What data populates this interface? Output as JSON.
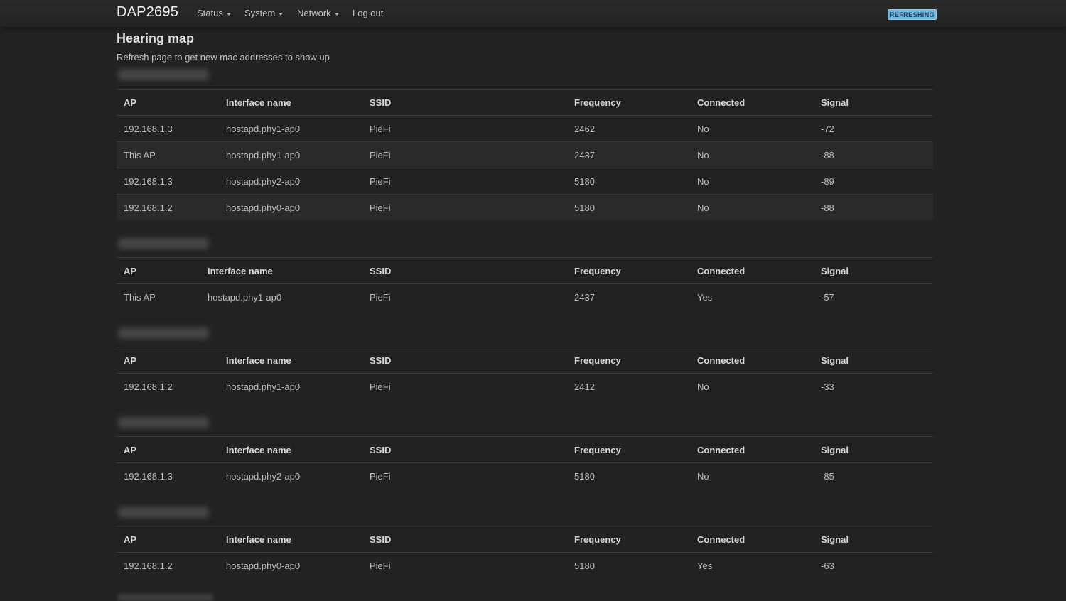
{
  "app": {
    "brand": "DAP2695",
    "status_badge": "REFRESHING"
  },
  "nav": [
    {
      "label": "Status",
      "dropdown": true
    },
    {
      "label": "System",
      "dropdown": true
    },
    {
      "label": "Network",
      "dropdown": true
    },
    {
      "label": "Log out",
      "dropdown": false
    }
  ],
  "page": {
    "title": "Hearing map",
    "subtitle": "Refresh page to get new mac addresses to show up"
  },
  "columns": [
    "AP",
    "Interface name",
    "SSID",
    "Frequency",
    "Connected",
    "Signal"
  ],
  "sections": [
    {
      "rows": [
        [
          "192.168.1.3",
          "hostapd.phy1-ap0",
          "PieFi",
          "2462",
          "No",
          "-72"
        ],
        [
          "This AP",
          "hostapd.phy1-ap0",
          "PieFi",
          "2437",
          "No",
          "-88"
        ],
        [
          "192.168.1.3",
          "hostapd.phy2-ap0",
          "PieFi",
          "5180",
          "No",
          "-89"
        ],
        [
          "192.168.1.2",
          "hostapd.phy0-ap0",
          "PieFi",
          "5180",
          "No",
          "-88"
        ]
      ]
    },
    {
      "rows": [
        [
          "This AP",
          "hostapd.phy1-ap0",
          "PieFi",
          "2437",
          "Yes",
          "-57"
        ]
      ]
    },
    {
      "rows": [
        [
          "192.168.1.2",
          "hostapd.phy1-ap0",
          "PieFi",
          "2412",
          "No",
          "-33"
        ]
      ]
    },
    {
      "rows": [
        [
          "192.168.1.3",
          "hostapd.phy2-ap0",
          "PieFi",
          "5180",
          "No",
          "-85"
        ]
      ]
    },
    {
      "rows": [
        [
          "192.168.1.2",
          "hostapd.phy0-ap0",
          "PieFi",
          "5180",
          "Yes",
          "-63"
        ]
      ]
    }
  ],
  "colors": {
    "background": "#222222",
    "navbar": "#262626",
    "badge": "#6bb9e1",
    "row_stripe": "#2a2a2a"
  }
}
